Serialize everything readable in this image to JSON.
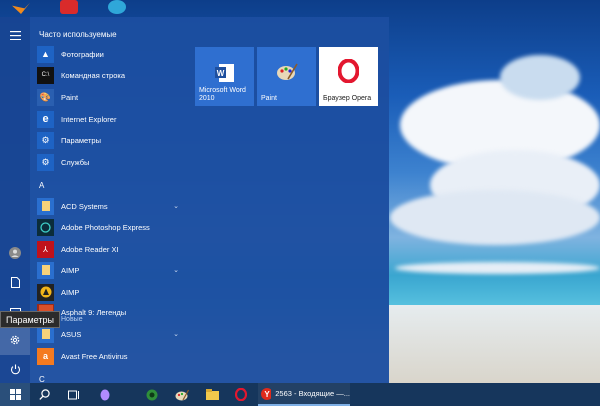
{
  "start_menu": {
    "frequent_header": "Часто используемые",
    "frequent_apps": [
      {
        "label": "Фотографии",
        "icon": "photos-icon",
        "color": "#1e63c4"
      },
      {
        "label": "Командная строка",
        "icon": "cmd-icon",
        "color": "#111111"
      },
      {
        "label": "Paint",
        "icon": "paint-icon",
        "color": "#2a5fb0"
      },
      {
        "label": "Internet Explorer",
        "icon": "ie-icon",
        "color": "#1e63c4"
      },
      {
        "label": "Параметры",
        "icon": "gear-icon",
        "color": "#1e63c4"
      },
      {
        "label": "Службы",
        "icon": "services-icon",
        "color": "#1e63c4"
      }
    ],
    "letter_a": "A",
    "letter_c": "C",
    "apps_a": [
      {
        "label": "ACD Systems",
        "icon": "folder-icon",
        "color": "#2a6fcf",
        "expandable": true
      },
      {
        "label": "Adobe Photoshop Express",
        "icon": "photoshop-express-icon",
        "color": "#0b2d3a"
      },
      {
        "label": "Adobe Reader XI",
        "icon": "adobe-reader-icon",
        "color": "#c0121b"
      },
      {
        "label": "AIMP",
        "icon": "folder-icon",
        "color": "#2a6fcf",
        "expandable": true
      },
      {
        "label": "AIMP",
        "icon": "aimp-icon",
        "color": "#222222"
      },
      {
        "label": "Asphalt 9: Легенды",
        "sublabel": "Новые",
        "icon": "asphalt-icon",
        "color": "#9a2b1c"
      },
      {
        "label": "ASUS",
        "icon": "folder-icon",
        "color": "#2a6fcf",
        "expandable": true
      },
      {
        "label": "Avast Free Antivirus",
        "icon": "avast-icon",
        "color": "#f47a20"
      }
    ],
    "tooltip": "Параметры",
    "tiles": [
      {
        "label": "Microsoft Word 2010",
        "icon": "word-icon",
        "bg": "#2f6fd0"
      },
      {
        "label": "Paint",
        "icon": "paint-icon",
        "bg": "#2f6fd0"
      },
      {
        "label": "Браузер Opera",
        "icon": "opera-icon",
        "bg": "#ffffff"
      }
    ]
  },
  "taskbar": {
    "running_app_title": "2563 - Входящие —...",
    "icons": [
      "windows-start-icon",
      "search-icon",
      "task-view-icon",
      "cortana-icon",
      "xbox-icon",
      "paint-icon",
      "file-explorer-icon",
      "opera-icon",
      "yandex-icon"
    ]
  }
}
